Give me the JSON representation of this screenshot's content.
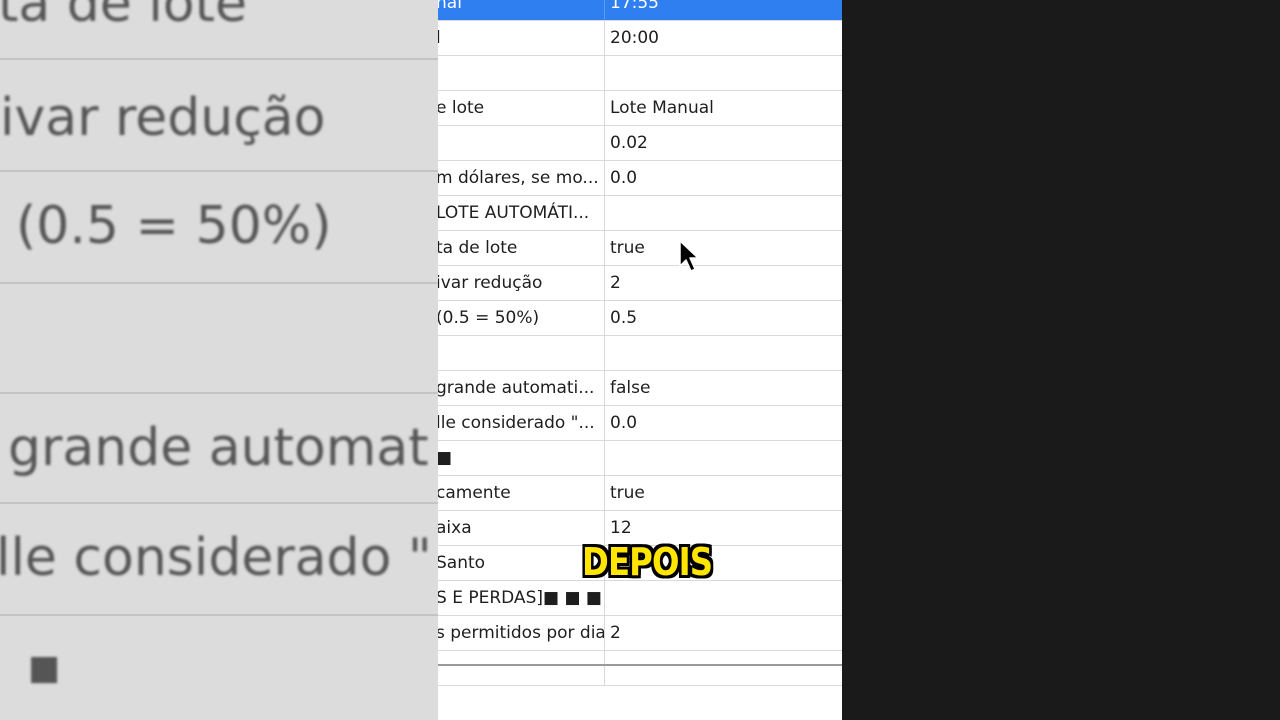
{
  "background_zoom": {
    "lines": [
      "ta de lote",
      "ivar redução",
      "(0.5 = 50%)",
      "grande automat",
      "lle considerado \"",
      "■"
    ]
  },
  "grid": {
    "rows": [
      {
        "name": "nal",
        "value": "17:55",
        "selected": true
      },
      {
        "name": "l",
        "value": "20:00"
      },
      {
        "name": "",
        "value": ""
      },
      {
        "name": "e lote",
        "value": "Lote Manual"
      },
      {
        "name": "",
        "value": "0.02"
      },
      {
        "name": "m dólares, se mo...",
        "value": "0.0"
      },
      {
        "name": "LOTE AUTOMÁTI...",
        "value": ""
      },
      {
        "name": "ta de lote",
        "value": "true"
      },
      {
        "name": "ivar redução",
        "value": "2"
      },
      {
        "name": "(0.5 = 50%)",
        "value": "0.5"
      },
      {
        "name": "",
        "value": ""
      },
      {
        "name": "grande automati...",
        "value": "false"
      },
      {
        "name": "lle considerado \"...",
        "value": "0.0"
      },
      {
        "name": "■",
        "value": ""
      },
      {
        "name": "camente",
        "value": "true"
      },
      {
        "name": "aixa",
        "value": "12"
      },
      {
        "name": "Santo",
        "value": ""
      },
      {
        "name": "S E PERDAS]■ ■ ■",
        "value": ""
      },
      {
        "name": "s permitidos por dia",
        "value": "2"
      },
      {
        "name": "",
        "value": ""
      }
    ]
  },
  "caption": "DEPOIS",
  "colors": {
    "selection": "#2f7ff0",
    "caption": "#ffe500"
  }
}
